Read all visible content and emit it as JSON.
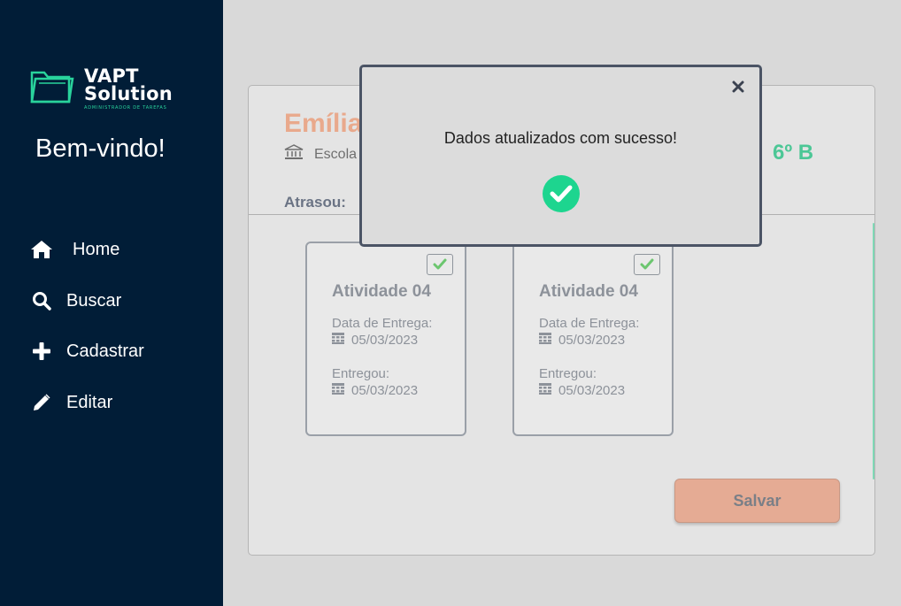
{
  "app": {
    "logo_line1": "VAPT",
    "logo_line2": "Solution",
    "logo_subtitle": "ADMINISTRADOR DE TAREFAS",
    "welcome": "Bem-vindo!"
  },
  "sidebar": {
    "items": [
      {
        "label": "Home",
        "icon": "home-icon"
      },
      {
        "label": "Buscar",
        "icon": "search-icon"
      },
      {
        "label": "Cadastrar",
        "icon": "plus-icon"
      },
      {
        "label": "Editar",
        "icon": "pencil-icon"
      }
    ]
  },
  "student": {
    "name": "Emília",
    "school": "Escola",
    "class": "6º B",
    "late_label": "Atrasou:"
  },
  "tasks": [
    {
      "title": "Atividade 04",
      "due_label": "Data de Entrega:",
      "due_date": "05/03/2023",
      "delivered_label": "Entregou:",
      "delivered_date": "05/03/2023",
      "checked": true
    },
    {
      "title": "Atividade 04",
      "due_label": "Data de Entrega:",
      "due_date": "05/03/2023",
      "delivered_label": "Entregou:",
      "delivered_date": "05/03/2023",
      "checked": true
    }
  ],
  "actions": {
    "save_label": "Salvar"
  },
  "modal": {
    "message": "Dados atualizados com sucesso!",
    "icon": "success-check-icon"
  },
  "colors": {
    "sidebar_bg": "#011d37",
    "accent_green": "#1dd58f",
    "accent_salmon": "#e5ab94",
    "class_green": "#4cc796"
  }
}
